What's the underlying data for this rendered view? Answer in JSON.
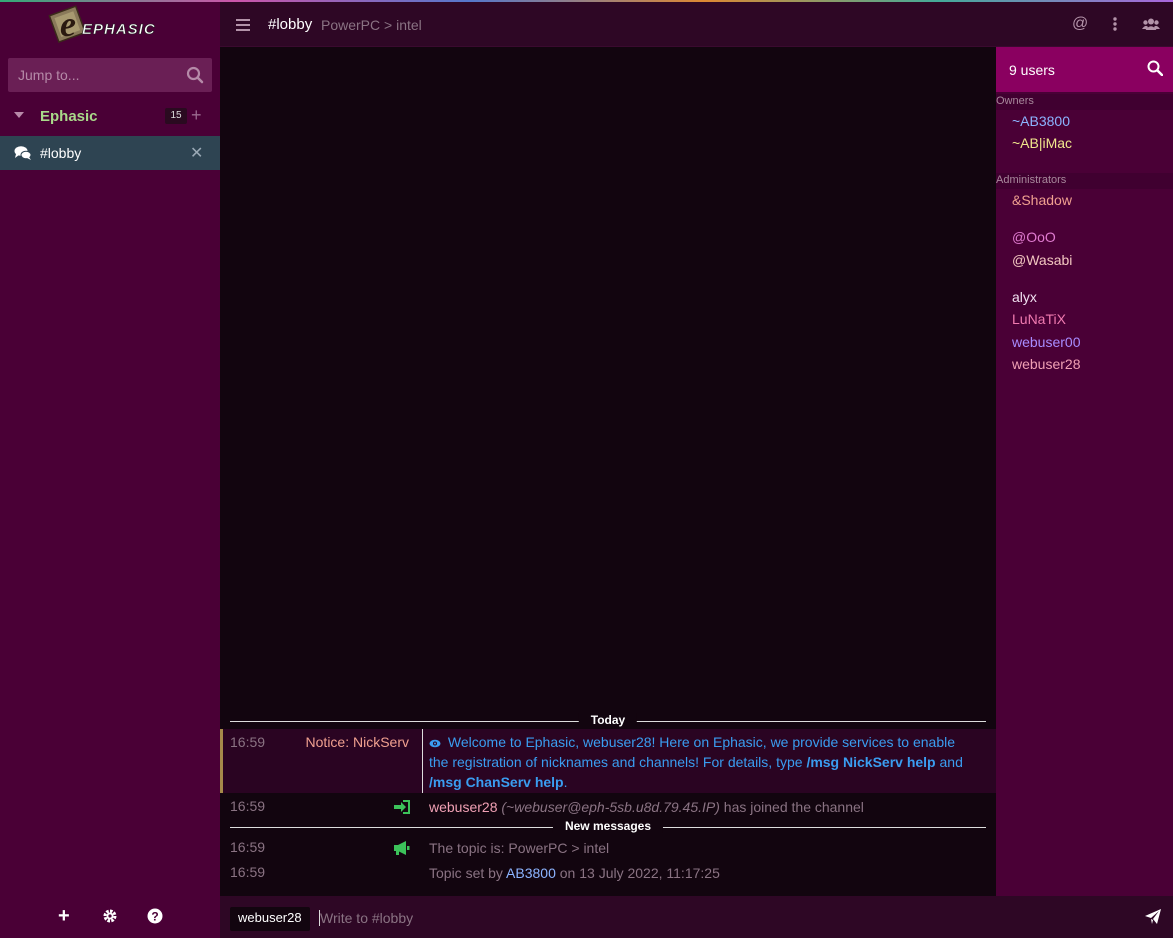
{
  "app": {
    "brand": "EPHASIC",
    "colors": {
      "sidebar": "#4a0036",
      "header": "#2e0725",
      "chat_bg": "#12050f",
      "userlist_head": "#8a0060",
      "active_channel": "#2e4452"
    }
  },
  "sidebar": {
    "jump_placeholder": "Jump to...",
    "network": {
      "name": "Ephasic",
      "badge": "15"
    },
    "channels": [
      {
        "name": "#lobby",
        "icon": "comments-icon"
      }
    ],
    "footer": {
      "add": "+",
      "settings": "gear-icon",
      "help": "question-icon"
    }
  },
  "header": {
    "channel": "#lobby",
    "topic": "PowerPC > intel"
  },
  "chat": {
    "today_label": "Today",
    "new_messages_label": "New messages",
    "notice": {
      "time": "16:59",
      "from": "Notice: NickServ",
      "text_1": "Welcome to Ephasic, webuser28! Here on Ephasic, we provide services to enable the registration of nicknames and channels! For details, type ",
      "cmd_1": "/msg NickServ help",
      "text_2": " and ",
      "cmd_2": "/msg ChanServ help",
      "text_3": "."
    },
    "join": {
      "time": "16:59",
      "nick": "webuser28",
      "host": "(~webuser@eph-5sb.u8d.79.45.IP)",
      "text": " has joined the channel"
    },
    "topic_msg": {
      "time": "16:59",
      "text": "The topic is: PowerPC > intel"
    },
    "topic_set": {
      "time": "16:59",
      "prefix": "Topic set by ",
      "nick": "AB3800",
      "suffix": " on 13 July 2022, 11:17:25"
    }
  },
  "composer": {
    "nick": "webuser28",
    "placeholder": "Write to #lobby"
  },
  "userlist": {
    "count": "9 users",
    "groups": [
      {
        "label": "Owners"
      },
      {
        "label": "Administrators"
      }
    ],
    "users": [
      {
        "nick": "~AB3800",
        "color": "#8cb4ff"
      },
      {
        "nick": "~AB|iMac",
        "color": "#f0e68c"
      },
      {
        "nick": "&Shadow",
        "color": "#f0a090"
      },
      {
        "nick": "@OoO",
        "color": "#e07ad0"
      },
      {
        "nick": "@Wasabi",
        "color": "#f2c6c0"
      },
      {
        "nick": "alyx",
        "color": "#f0e0f0"
      },
      {
        "nick": "LuNaTiX",
        "color": "#f07ab0"
      },
      {
        "nick": "webuser00",
        "color": "#a88cff"
      },
      {
        "nick": "webuser28",
        "color": "#f0a0b4"
      }
    ]
  }
}
